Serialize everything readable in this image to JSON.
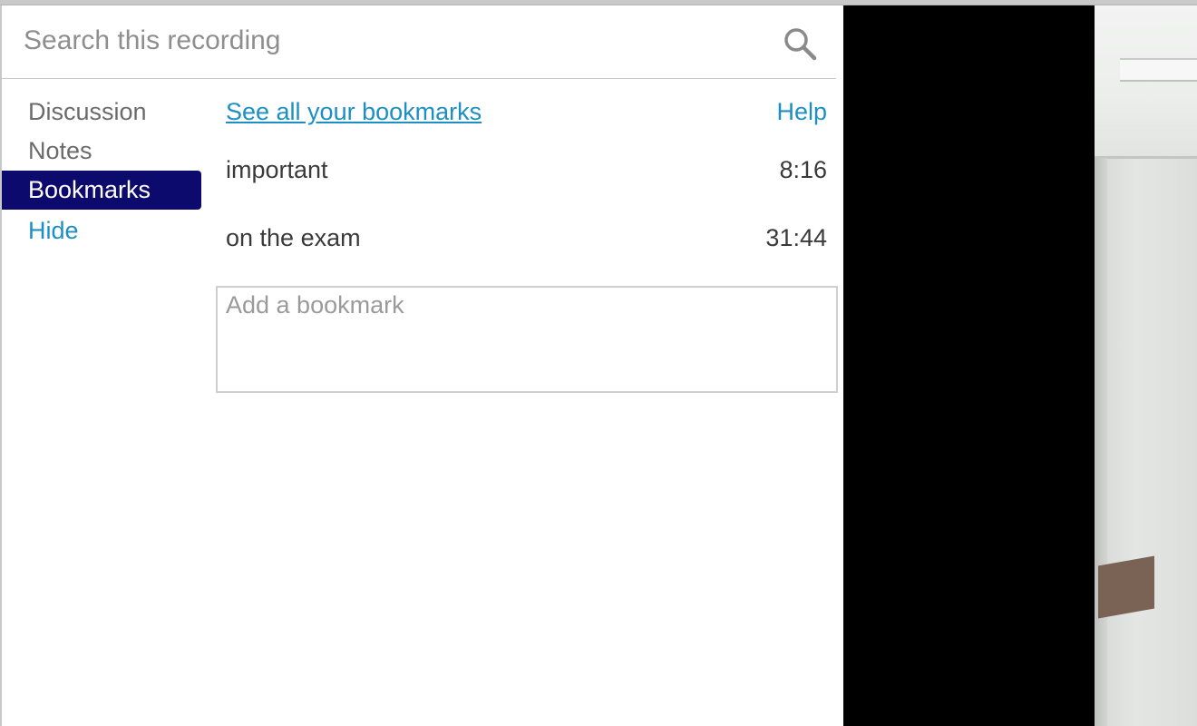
{
  "search": {
    "placeholder": "Search this recording",
    "icon": "search-icon"
  },
  "nav": {
    "items": [
      {
        "label": "Discussion"
      },
      {
        "label": "Notes"
      },
      {
        "label": "Bookmarks",
        "active": true
      },
      {
        "label": "Hide"
      }
    ]
  },
  "bookmarks": {
    "see_all_label": "See all your bookmarks",
    "help_label": "Help",
    "items": [
      {
        "label": "important",
        "time": "8:16"
      },
      {
        "label": "on the exam",
        "time": "31:44"
      }
    ],
    "add_placeholder": "Add a bookmark"
  },
  "colors": {
    "accent_link": "#1c8fc4",
    "active_nav_bg": "#0d0a6e",
    "video_bg": "#000000"
  }
}
